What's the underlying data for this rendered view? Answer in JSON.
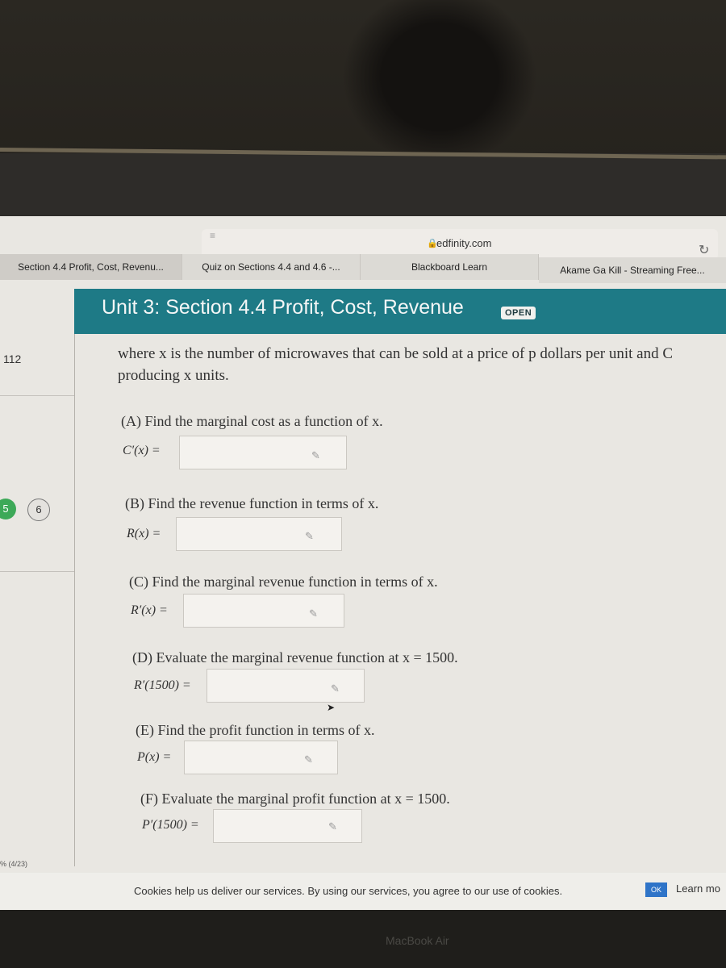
{
  "browser": {
    "url": "edfinity.com",
    "tabs": [
      {
        "label": "Section 4.4 Profit, Cost, Revenu...",
        "active": true
      },
      {
        "label": "Quiz on Sections 4.4 and 4.6 -...",
        "active": false
      },
      {
        "label": "Blackboard Learn",
        "active": false
      },
      {
        "label": "Akame Ga Kill - Streaming Free...",
        "active": false
      }
    ]
  },
  "header": {
    "title": "Unit 3: Section 4.4 Profit, Cost, Revenue",
    "badge": "OPEN",
    "accent_color": "#1e7a86"
  },
  "left_panel": {
    "score_fragment": "112",
    "question_numbers": [
      {
        "label": "5",
        "status": "done",
        "color": "#3da958"
      },
      {
        "label": "6",
        "status": "current"
      }
    ],
    "date_fragment": "% (4/23)"
  },
  "problem": {
    "intro_line1": "where x is the number of microwaves that can be sold at a price of p dollars per unit and C",
    "intro_line2": "producing x units.",
    "parts": [
      {
        "prompt": "(A) Find the marginal cost as a function of x.",
        "label": "C′(x) =",
        "value": ""
      },
      {
        "prompt": "(B) Find the revenue function in terms of x.",
        "label": "R(x) =",
        "value": ""
      },
      {
        "prompt": "(C) Find the marginal revenue function in terms of x.",
        "label": "R′(x) =",
        "value": ""
      },
      {
        "prompt": "(D) Evaluate the marginal revenue function at x = 1500.",
        "label": "R′(1500) =",
        "value": ""
      },
      {
        "prompt": "(E) Find the profit function in terms of x.",
        "label": "P(x) =",
        "value": ""
      },
      {
        "prompt": "(F) Evaluate the marginal profit function at x = 1500.",
        "label": "P′(1500) =",
        "value": ""
      }
    ]
  },
  "cookie_bar": {
    "text": "Cookies help us deliver our services. By using our services, you agree to our use of cookies.",
    "ok_label": "OK",
    "learn_more": "Learn mo"
  },
  "device": {
    "label": "MacBook Air"
  }
}
